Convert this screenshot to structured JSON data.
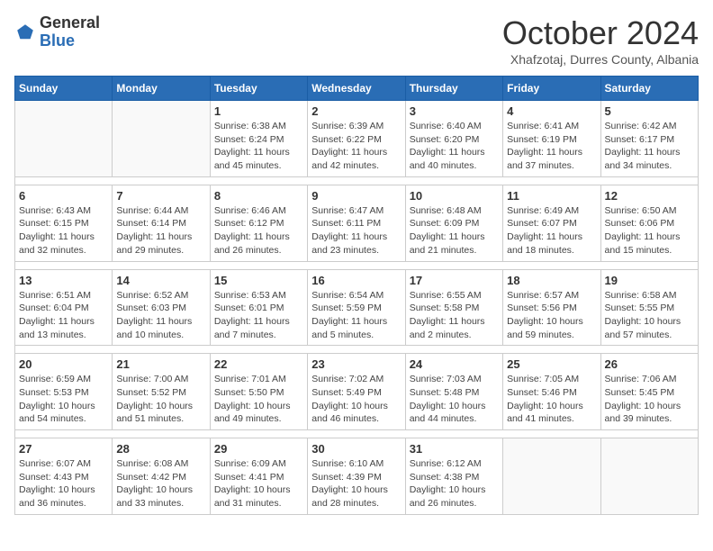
{
  "header": {
    "logo_general": "General",
    "logo_blue": "Blue",
    "month_title": "October 2024",
    "subtitle": "Xhafzotaj, Durres County, Albania"
  },
  "days_of_week": [
    "Sunday",
    "Monday",
    "Tuesday",
    "Wednesday",
    "Thursday",
    "Friday",
    "Saturday"
  ],
  "weeks": [
    [
      {
        "day": "",
        "info": ""
      },
      {
        "day": "",
        "info": ""
      },
      {
        "day": "1",
        "info": "Sunrise: 6:38 AM\nSunset: 6:24 PM\nDaylight: 11 hours and 45 minutes."
      },
      {
        "day": "2",
        "info": "Sunrise: 6:39 AM\nSunset: 6:22 PM\nDaylight: 11 hours and 42 minutes."
      },
      {
        "day": "3",
        "info": "Sunrise: 6:40 AM\nSunset: 6:20 PM\nDaylight: 11 hours and 40 minutes."
      },
      {
        "day": "4",
        "info": "Sunrise: 6:41 AM\nSunset: 6:19 PM\nDaylight: 11 hours and 37 minutes."
      },
      {
        "day": "5",
        "info": "Sunrise: 6:42 AM\nSunset: 6:17 PM\nDaylight: 11 hours and 34 minutes."
      }
    ],
    [
      {
        "day": "6",
        "info": "Sunrise: 6:43 AM\nSunset: 6:15 PM\nDaylight: 11 hours and 32 minutes."
      },
      {
        "day": "7",
        "info": "Sunrise: 6:44 AM\nSunset: 6:14 PM\nDaylight: 11 hours and 29 minutes."
      },
      {
        "day": "8",
        "info": "Sunrise: 6:46 AM\nSunset: 6:12 PM\nDaylight: 11 hours and 26 minutes."
      },
      {
        "day": "9",
        "info": "Sunrise: 6:47 AM\nSunset: 6:11 PM\nDaylight: 11 hours and 23 minutes."
      },
      {
        "day": "10",
        "info": "Sunrise: 6:48 AM\nSunset: 6:09 PM\nDaylight: 11 hours and 21 minutes."
      },
      {
        "day": "11",
        "info": "Sunrise: 6:49 AM\nSunset: 6:07 PM\nDaylight: 11 hours and 18 minutes."
      },
      {
        "day": "12",
        "info": "Sunrise: 6:50 AM\nSunset: 6:06 PM\nDaylight: 11 hours and 15 minutes."
      }
    ],
    [
      {
        "day": "13",
        "info": "Sunrise: 6:51 AM\nSunset: 6:04 PM\nDaylight: 11 hours and 13 minutes."
      },
      {
        "day": "14",
        "info": "Sunrise: 6:52 AM\nSunset: 6:03 PM\nDaylight: 11 hours and 10 minutes."
      },
      {
        "day": "15",
        "info": "Sunrise: 6:53 AM\nSunset: 6:01 PM\nDaylight: 11 hours and 7 minutes."
      },
      {
        "day": "16",
        "info": "Sunrise: 6:54 AM\nSunset: 5:59 PM\nDaylight: 11 hours and 5 minutes."
      },
      {
        "day": "17",
        "info": "Sunrise: 6:55 AM\nSunset: 5:58 PM\nDaylight: 11 hours and 2 minutes."
      },
      {
        "day": "18",
        "info": "Sunrise: 6:57 AM\nSunset: 5:56 PM\nDaylight: 10 hours and 59 minutes."
      },
      {
        "day": "19",
        "info": "Sunrise: 6:58 AM\nSunset: 5:55 PM\nDaylight: 10 hours and 57 minutes."
      }
    ],
    [
      {
        "day": "20",
        "info": "Sunrise: 6:59 AM\nSunset: 5:53 PM\nDaylight: 10 hours and 54 minutes."
      },
      {
        "day": "21",
        "info": "Sunrise: 7:00 AM\nSunset: 5:52 PM\nDaylight: 10 hours and 51 minutes."
      },
      {
        "day": "22",
        "info": "Sunrise: 7:01 AM\nSunset: 5:50 PM\nDaylight: 10 hours and 49 minutes."
      },
      {
        "day": "23",
        "info": "Sunrise: 7:02 AM\nSunset: 5:49 PM\nDaylight: 10 hours and 46 minutes."
      },
      {
        "day": "24",
        "info": "Sunrise: 7:03 AM\nSunset: 5:48 PM\nDaylight: 10 hours and 44 minutes."
      },
      {
        "day": "25",
        "info": "Sunrise: 7:05 AM\nSunset: 5:46 PM\nDaylight: 10 hours and 41 minutes."
      },
      {
        "day": "26",
        "info": "Sunrise: 7:06 AM\nSunset: 5:45 PM\nDaylight: 10 hours and 39 minutes."
      }
    ],
    [
      {
        "day": "27",
        "info": "Sunrise: 6:07 AM\nSunset: 4:43 PM\nDaylight: 10 hours and 36 minutes."
      },
      {
        "day": "28",
        "info": "Sunrise: 6:08 AM\nSunset: 4:42 PM\nDaylight: 10 hours and 33 minutes."
      },
      {
        "day": "29",
        "info": "Sunrise: 6:09 AM\nSunset: 4:41 PM\nDaylight: 10 hours and 31 minutes."
      },
      {
        "day": "30",
        "info": "Sunrise: 6:10 AM\nSunset: 4:39 PM\nDaylight: 10 hours and 28 minutes."
      },
      {
        "day": "31",
        "info": "Sunrise: 6:12 AM\nSunset: 4:38 PM\nDaylight: 10 hours and 26 minutes."
      },
      {
        "day": "",
        "info": ""
      },
      {
        "day": "",
        "info": ""
      }
    ]
  ]
}
